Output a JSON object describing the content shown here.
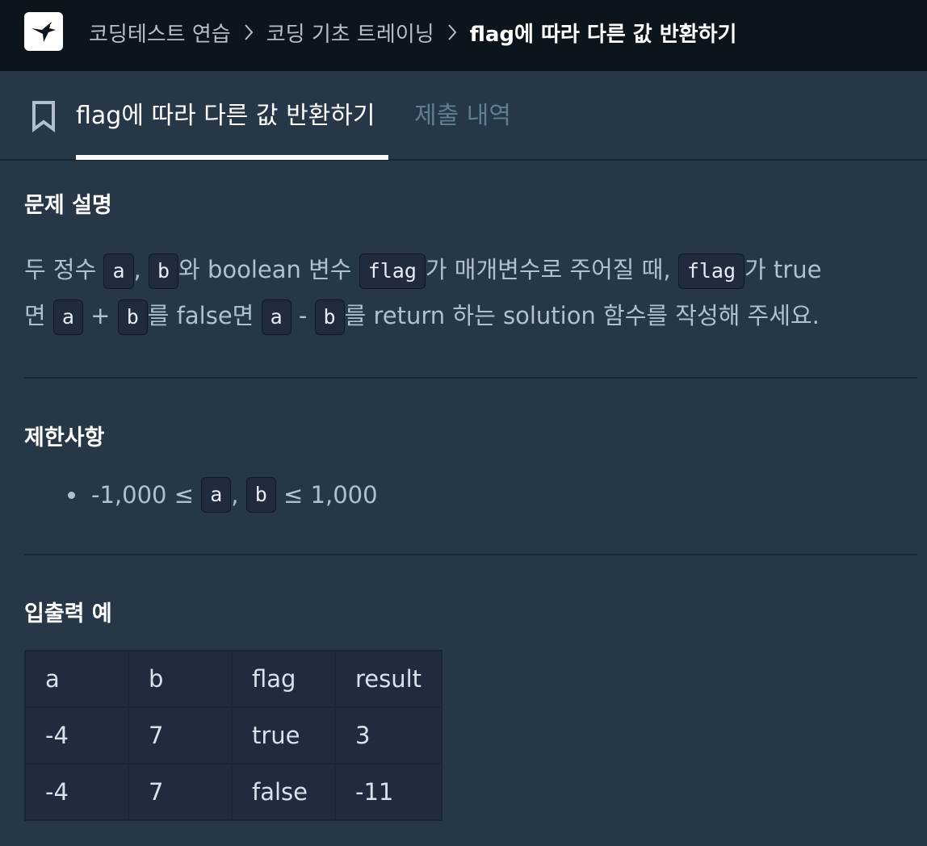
{
  "header": {
    "logo_icon": "hummingbird-logo-icon",
    "breadcrumb": [
      {
        "label": "코딩테스트 연습"
      },
      {
        "label": "코딩 기초 트레이닝"
      },
      {
        "label": "flag에 따라 다른 값 반환하기"
      }
    ]
  },
  "tabs": {
    "bookmark_icon": "bookmark-icon",
    "active": "flag에 따라 다른 값 반환하기",
    "inactive": "제출 내역"
  },
  "problem": {
    "title": "문제 설명",
    "line1": {
      "t1": "두 정수 ",
      "c1": "a",
      "t2": ", ",
      "c2": "b",
      "t3": "와 boolean 변수 ",
      "c3": "flag",
      "t4": "가 매개변수로 주어질 때, ",
      "c4": "flag",
      "t5": "가 true"
    },
    "line2": {
      "t1": "면 ",
      "c1": "a",
      "t2": " + ",
      "c2": "b",
      "t3": "를 false면 ",
      "c3": "a",
      "t4": " - ",
      "c4": "b",
      "t5": "를 return 하는 solution 함수를 작성해 주세요."
    }
  },
  "constraints": {
    "title": "제한사항",
    "item": {
      "t1": "-1,000 ≤ ",
      "c1": "a",
      "t2": ", ",
      "c2": "b",
      "t3": " ≤ 1,000"
    }
  },
  "examples": {
    "title": "입출력 예",
    "headers": [
      "a",
      "b",
      "flag",
      "result"
    ],
    "rows": [
      [
        "-4",
        "7",
        "true",
        "3"
      ],
      [
        "-4",
        "7",
        "false",
        "-11"
      ]
    ]
  },
  "colors": {
    "topbar": "#0c151c",
    "background": "#263747",
    "code_bg": "#202b3d",
    "active_tab": "#ffffff",
    "inactive_tab": "#5f7f90"
  }
}
